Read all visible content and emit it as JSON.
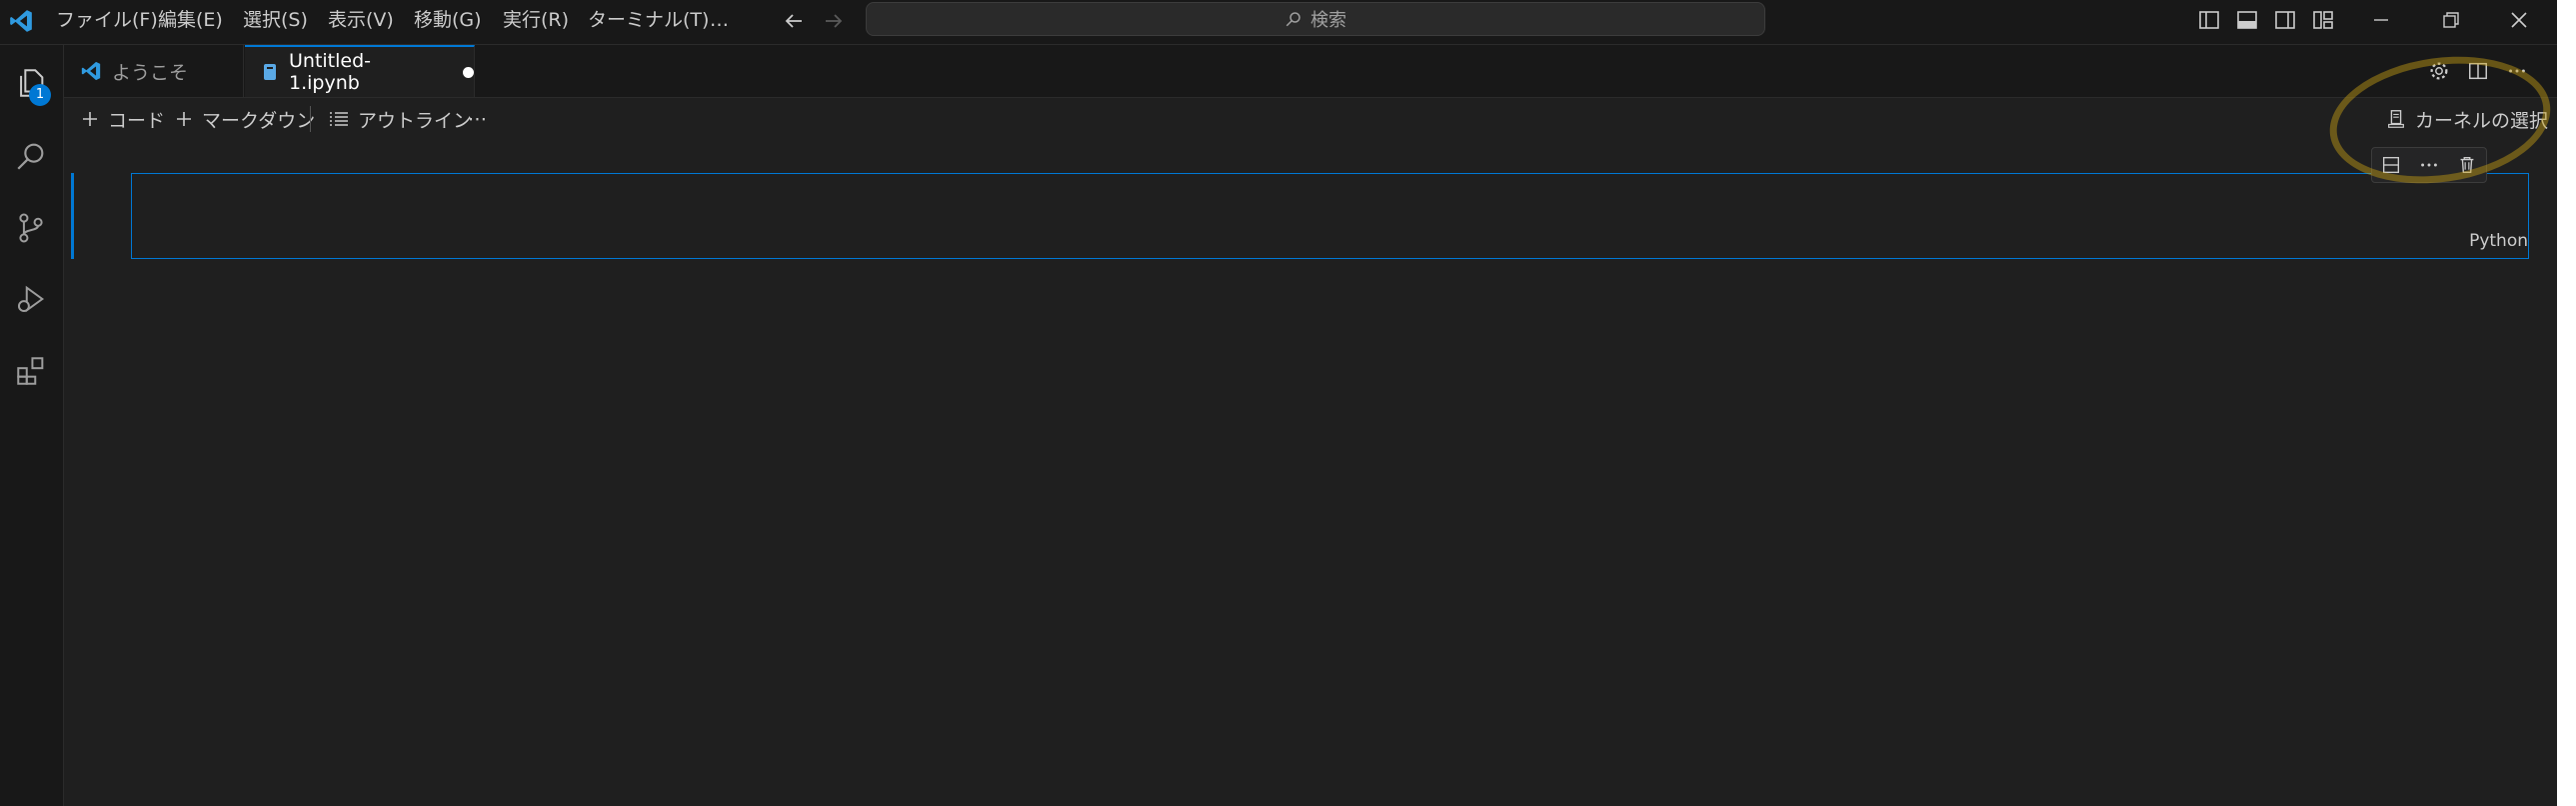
{
  "titlebar": {
    "menus": [
      "ファイル(F)",
      "編集(E)",
      "選択(S)",
      "表示(V)",
      "移動(G)",
      "実行(R)",
      "ターミナル(T)",
      "…"
    ],
    "search_placeholder": "検索"
  },
  "activitybar": {
    "explorer_badge": "1"
  },
  "tabs": [
    {
      "label": "ようこそ",
      "active": false
    },
    {
      "label": "Untitled-1.ipynb",
      "active": true,
      "dirty": true
    }
  ],
  "notebook_toolbar": {
    "code": "コード",
    "markdown": "マークダウン",
    "outline": "アウトライン",
    "more": "⋯",
    "kernel_select": "カーネルの選択"
  },
  "cell": {
    "language": "Python"
  },
  "colors": {
    "accent": "#0078d4",
    "highlight": "#c8a014"
  }
}
